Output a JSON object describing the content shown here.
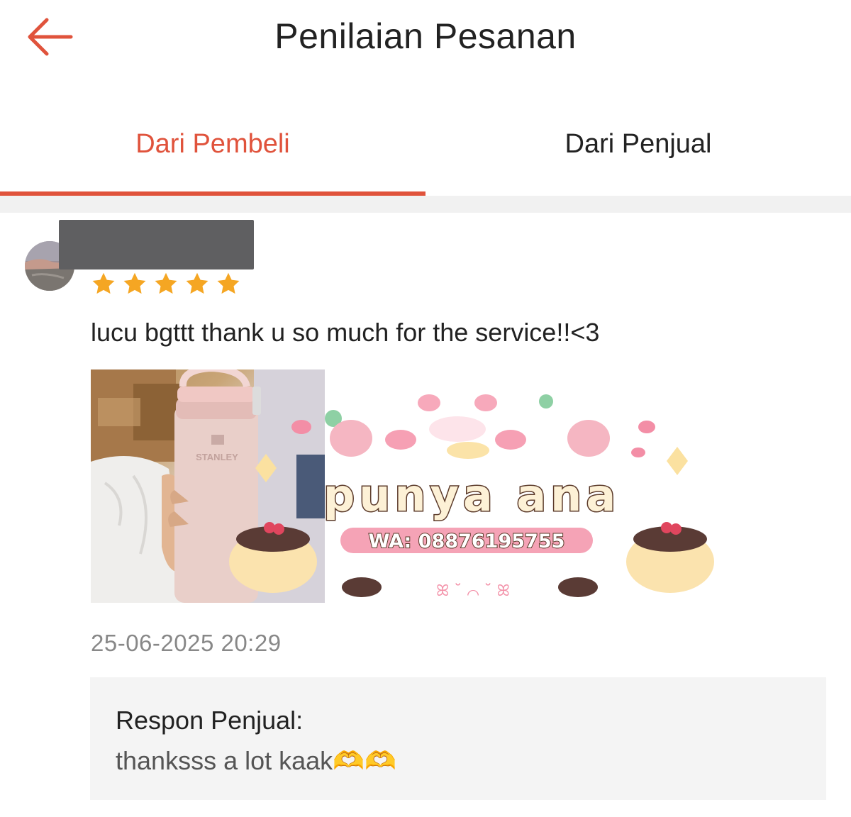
{
  "header": {
    "title": "Penilaian Pesanan",
    "back_icon": "arrow-left-icon",
    "accent_color": "#e0533c"
  },
  "tabs": [
    {
      "label": "Dari Pembeli",
      "active": true
    },
    {
      "label": "Dari Penjual",
      "active": false
    }
  ],
  "review": {
    "rating": 5,
    "rating_max": 5,
    "star_color": "#f5a623",
    "text": "lucu bgttt thank u so much for the service!!<3",
    "photo_brand": "STANLEY",
    "timestamp": "25-06-2025 20:29",
    "seller_response": {
      "title": "Respon Penjual:",
      "text": "thanksss a lot kaak🫶🫶"
    }
  },
  "watermark": {
    "name": "punya ana",
    "contact": "WA: 08876195755"
  }
}
